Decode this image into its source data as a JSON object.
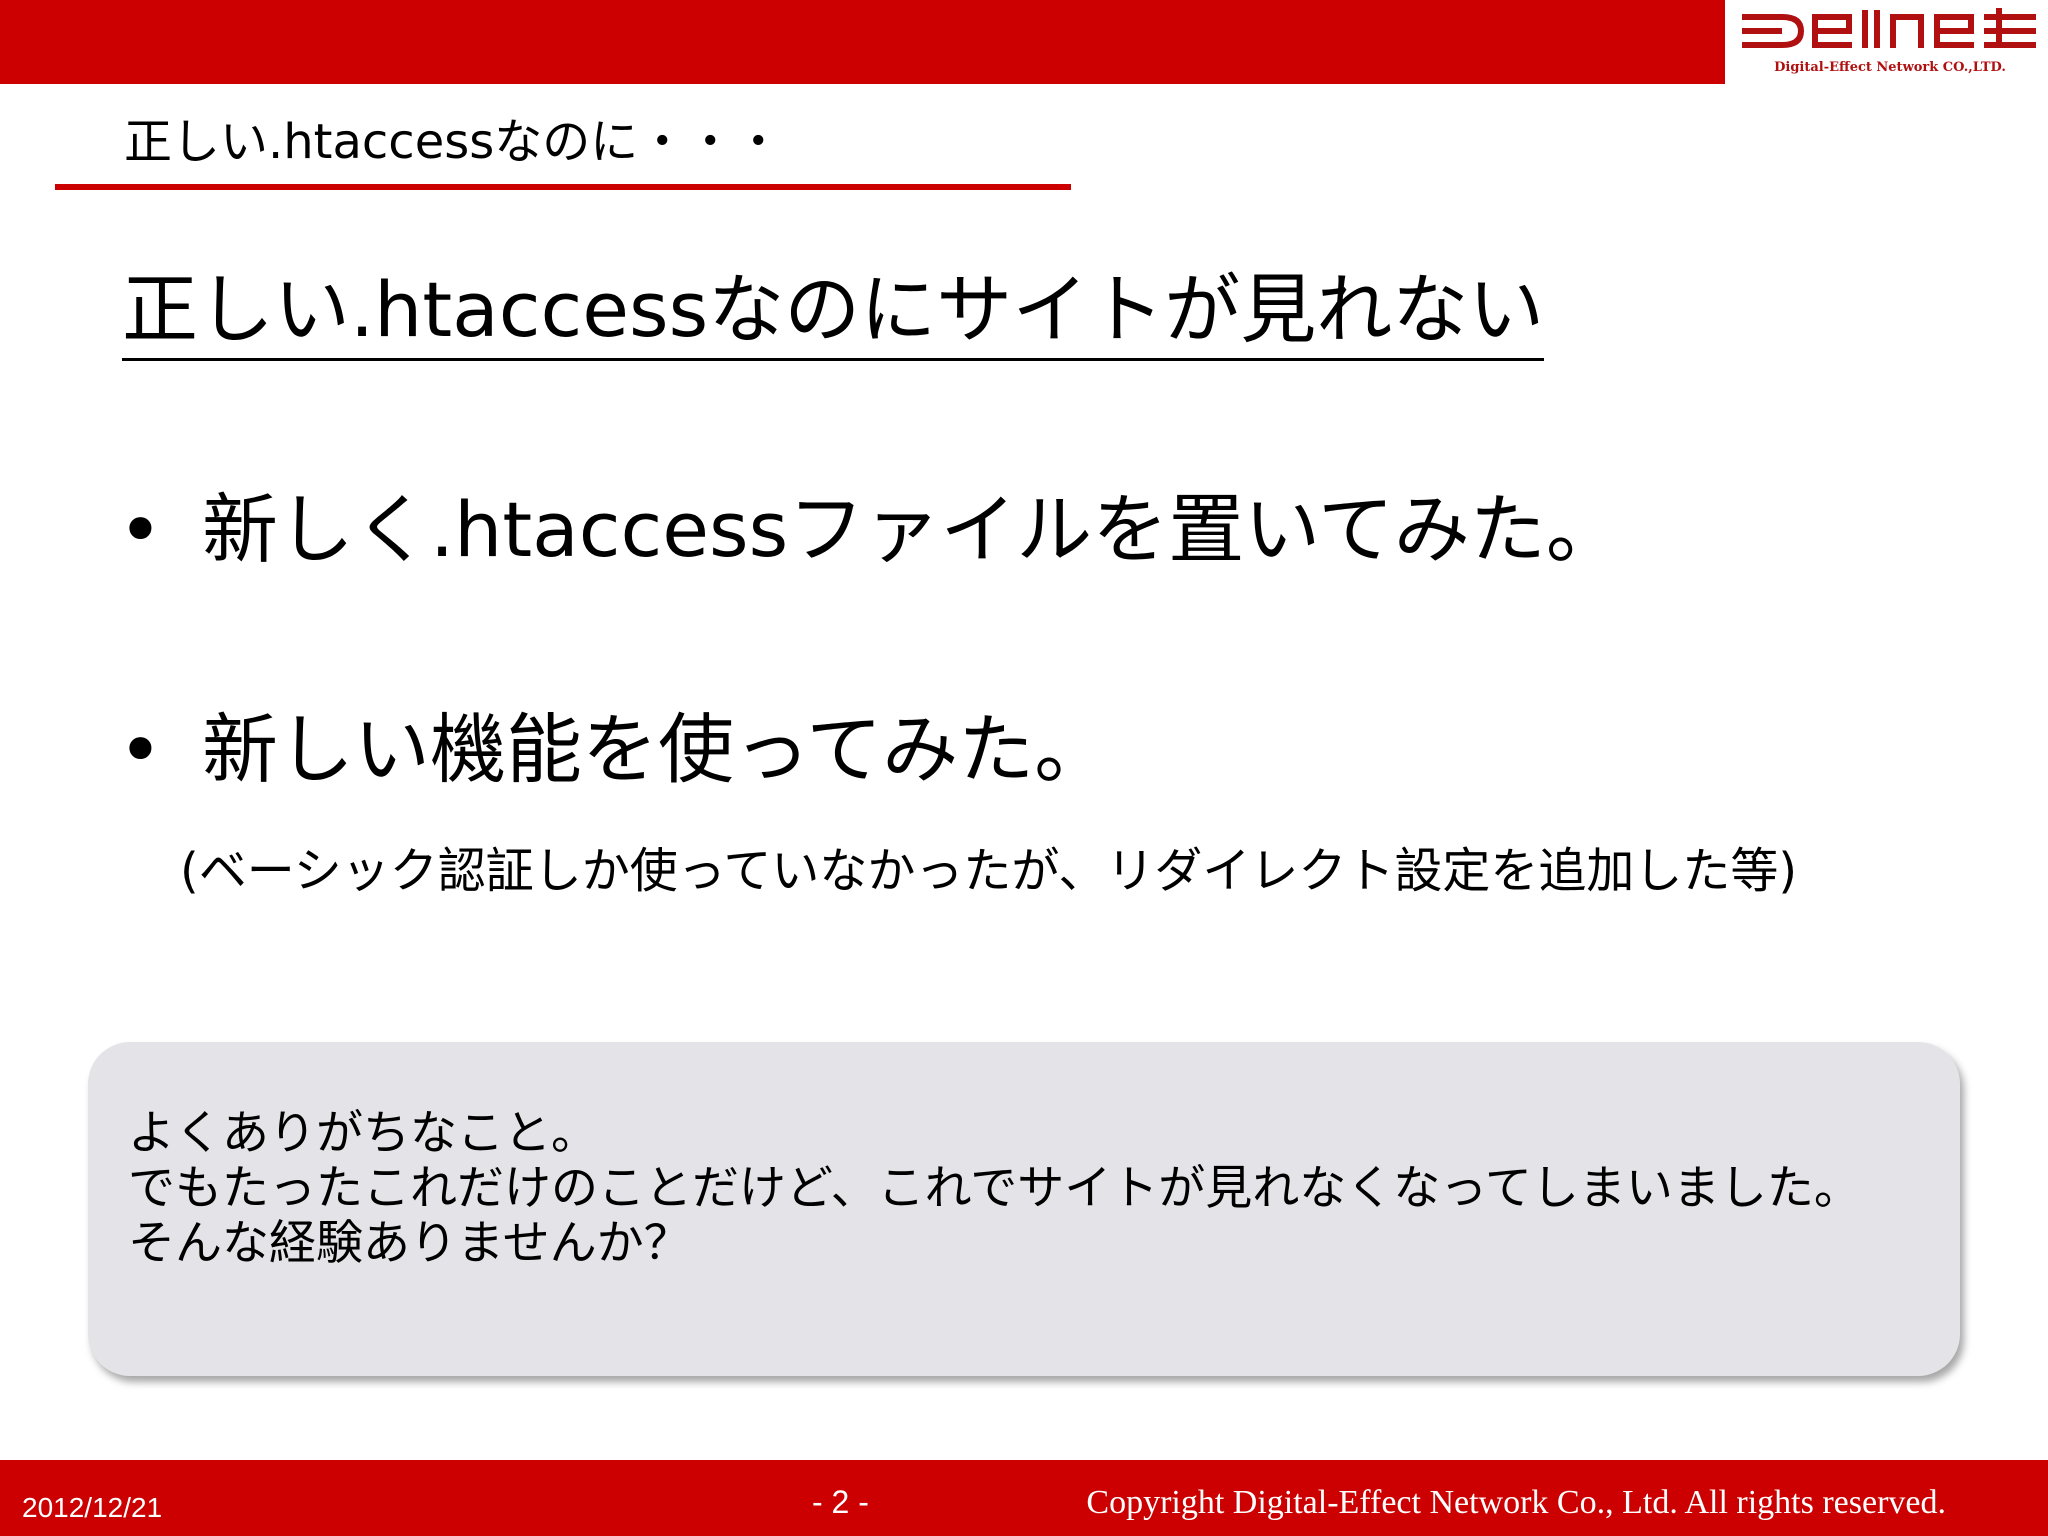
{
  "header": {
    "title": "正しい.htaccessなのに・・・",
    "logo_text": "Digital-Effect Network CO.,LTD.",
    "logo_brand": "DEllnet",
    "accent_color": "#cc0000"
  },
  "main": {
    "heading": "正しい.htaccessなのにサイトが見れない",
    "bullet_symbol": "•",
    "bullets": [
      {
        "text": "新しく.htaccessファイルを置いてみた。"
      },
      {
        "text": "新しい機能を使ってみた。"
      }
    ],
    "note": "(ベーシック認証しか使っていなかったが、リダイレクト設定を追加した等)"
  },
  "callout": {
    "lines": [
      "よくありがちなこと。",
      "でもたったこれだけのことだけど、これでサイトが見れなくなってしまいました。",
      "そんな経験ありませんか？"
    ],
    "background_color": "#e4e3e7"
  },
  "footer": {
    "date": "2012/12/21",
    "page": "- 2 -",
    "copyright": "Copyright Digital-Effect Network Co., Ltd. All rights reserved."
  }
}
